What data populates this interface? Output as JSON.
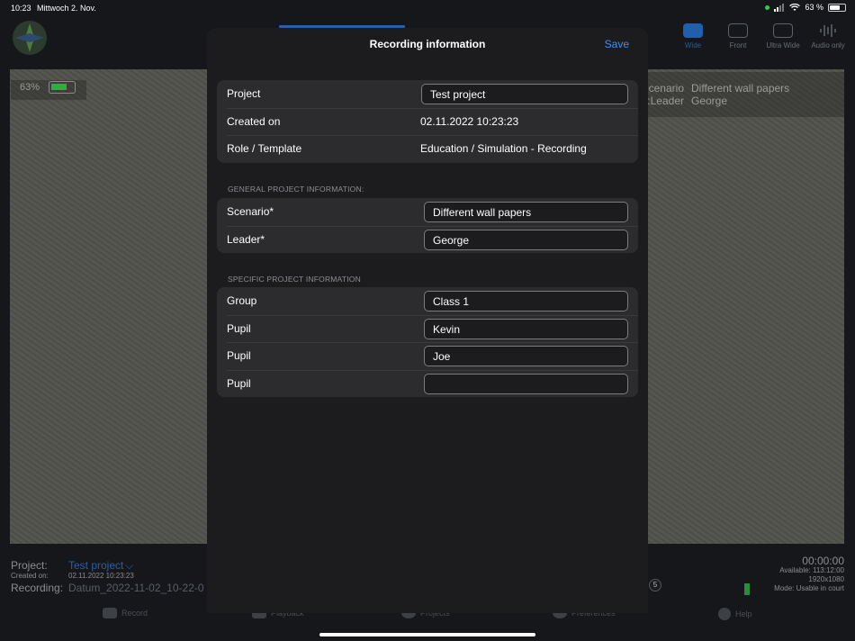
{
  "status": {
    "time": "10:23",
    "date": "Mittwoch 2. Nov.",
    "battery": "63 %"
  },
  "camera": [
    {
      "label": "Wide",
      "icon": "camera-icon",
      "active": true
    },
    {
      "label": "Front",
      "icon": "camera-rotate-icon",
      "active": false
    },
    {
      "label": "Ultra Wide",
      "icon": "camera-rotate-icon",
      "active": false
    },
    {
      "label": "Audio only",
      "icon": "waveform-icon",
      "active": false
    }
  ],
  "preview": {
    "battery_pct": "63%"
  },
  "overlay": {
    "k1": "Scenario:",
    "v1": "Different wall papers",
    "k2": "Leader:",
    "v2": "George"
  },
  "bottom": {
    "project_label": "Project:",
    "project_value": "Test project",
    "created_label": "Created on:",
    "created_value": "02.11.2022 10:23:23",
    "recording_label": "Recording:",
    "recording_value": "Datum_2022-11-02_10-22-0",
    "duration": "00:00:00",
    "available": "Available: 113:12:00",
    "resolution": "1920x1080",
    "mode": "Mode: Usable in court",
    "badge": "5"
  },
  "tabs": {
    "record": "Record",
    "playback": "Playback",
    "projects": "Projects",
    "preferences": "Preferences",
    "help": "Help"
  },
  "modal": {
    "title": "Recording information",
    "save": "Save",
    "project_label": "Project",
    "project_value": "Test project",
    "created_label": "Created on",
    "created_value": "02.11.2022 10:23:23",
    "role_label": "Role / Template",
    "role_value": "Education / Simulation - Recording",
    "general_header": "GENERAL PROJECT INFORMATION:",
    "scenario_label": "Scenario*",
    "scenario_value": "Different wall papers",
    "leader_label": "Leader*",
    "leader_value": "George",
    "specific_header": "SPECIFIC PROJECT INFORMATION",
    "group_label": "Group",
    "group_value": "Class 1",
    "pupil1_label": "Pupil",
    "pupil1_value": "Kevin",
    "pupil2_label": "Pupil",
    "pupil2_value": "Joe",
    "pupil3_label": "Pupil",
    "pupil3_value": ""
  }
}
